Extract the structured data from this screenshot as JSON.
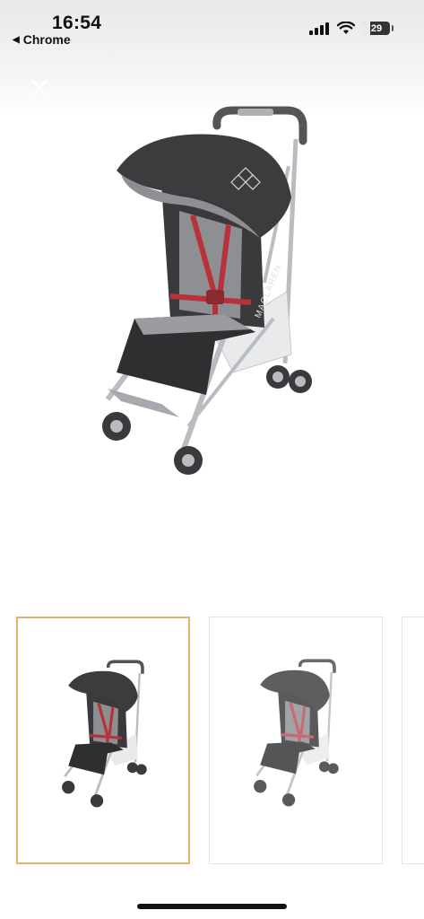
{
  "status_bar": {
    "time": "16:54",
    "back_app": "Chrome",
    "battery": "29",
    "icons": [
      "cellular-signal-icon",
      "wifi-icon",
      "battery-icon"
    ]
  },
  "viewer": {
    "close_icon": "close-icon",
    "main_image": "stroller-product-image",
    "brand_text_on_product": "MACLAREN"
  },
  "thumbnails": [
    {
      "name": "stroller-thumbnail-1",
      "selected": true
    },
    {
      "name": "stroller-thumbnail-2",
      "selected": false
    },
    {
      "name": "stroller-thumbnail-3-partial",
      "selected": false
    }
  ],
  "colors": {
    "selected_border": "#e8b064",
    "stroller_body": "#3a3a3c",
    "harness": "#b8323a",
    "frame": "#b9bcc0"
  }
}
